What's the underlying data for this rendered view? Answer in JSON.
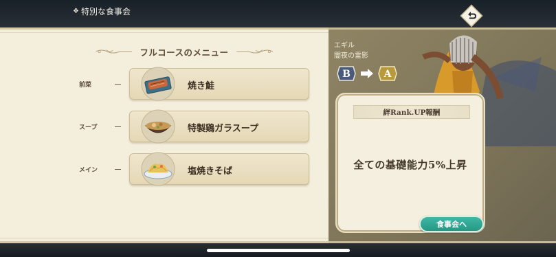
{
  "header": {
    "title": "特別な食事会",
    "title_icon": "diamond-icon",
    "back_icon": "return-arrow-icon"
  },
  "menu": {
    "title": "フルコースのメニュー",
    "courses": [
      {
        "label": "前菜",
        "dish": "焼き鮭",
        "icon": "grilled-salmon-icon"
      },
      {
        "label": "スープ",
        "dish": "特製鶏ガラスープ",
        "icon": "soup-bowl-icon"
      },
      {
        "label": "メイン",
        "dish": "塩焼きそば",
        "icon": "fried-noodles-icon"
      }
    ]
  },
  "character": {
    "name": "エギル",
    "title": "闇夜の雷影",
    "rank_from": "B",
    "rank_to": "A"
  },
  "reward": {
    "header": "絆Rank.UP報酬",
    "text": "全ての基礎能力5%上昇",
    "button": "食事会へ"
  },
  "colors": {
    "panel": "#f4eedd",
    "accent_button": "#2fa893",
    "right_bg": "#8a7f60"
  }
}
